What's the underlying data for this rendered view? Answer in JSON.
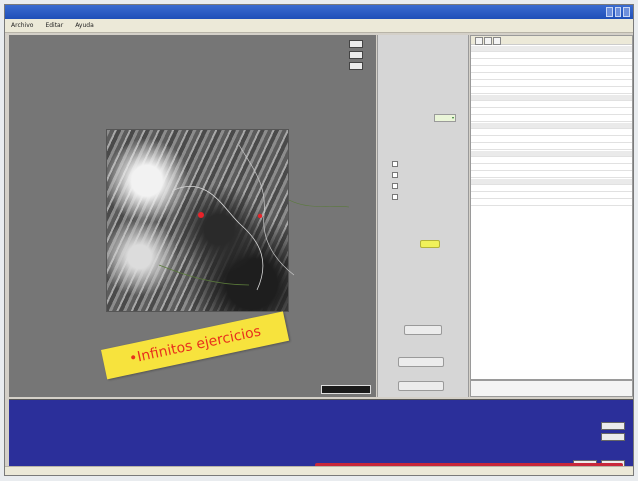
{
  "window": {
    "title": ""
  },
  "menu": [
    "Archivo",
    "Editar",
    "Ayuda"
  ],
  "viewer": {
    "zoom_buttons": [
      "",
      "",
      ""
    ],
    "coords": ""
  },
  "controls": {
    "load_label": "",
    "display_label": "",
    "display_value": "",
    "checkboxes": [
      "",
      "",
      "",
      ""
    ],
    "selector_label": "",
    "selector_value": "",
    "mid_label": "",
    "buttons": [
      "",
      "",
      ""
    ]
  },
  "properties": {
    "groups": [
      {
        "name": "",
        "rows": [
          [
            "",
            ""
          ],
          [
            "",
            ""
          ],
          [
            "",
            ""
          ],
          [
            "",
            ""
          ],
          [
            "",
            ""
          ],
          [
            "",
            ""
          ]
        ]
      },
      {
        "name": "",
        "rows": [
          [
            "",
            ""
          ],
          [
            "",
            ""
          ],
          [
            "",
            ""
          ]
        ]
      },
      {
        "name": "",
        "rows": [
          [
            "",
            ""
          ],
          [
            "",
            ""
          ],
          [
            "",
            ""
          ]
        ]
      },
      {
        "name": "",
        "rows": [
          [
            "",
            ""
          ],
          [
            "",
            ""
          ],
          [
            "",
            ""
          ]
        ]
      },
      {
        "name": "",
        "rows": [
          [
            "",
            ""
          ],
          [
            "",
            ""
          ],
          [
            "",
            ""
          ]
        ]
      }
    ],
    "description": {
      "title": "",
      "text": ""
    }
  },
  "console": {
    "buttons": [
      "",
      "",
      "",
      ""
    ]
  },
  "annotation": {
    "text": "•Infinitos ejercicios"
  },
  "colors": {
    "title_bar": "#2a5cc6",
    "console_bg": "#2b2f9a",
    "annotation_bg": "#f7e33d",
    "annotation_text": "#e8301c",
    "accent_red": "#c8283a",
    "selector_highlight": "#f1f25a"
  }
}
